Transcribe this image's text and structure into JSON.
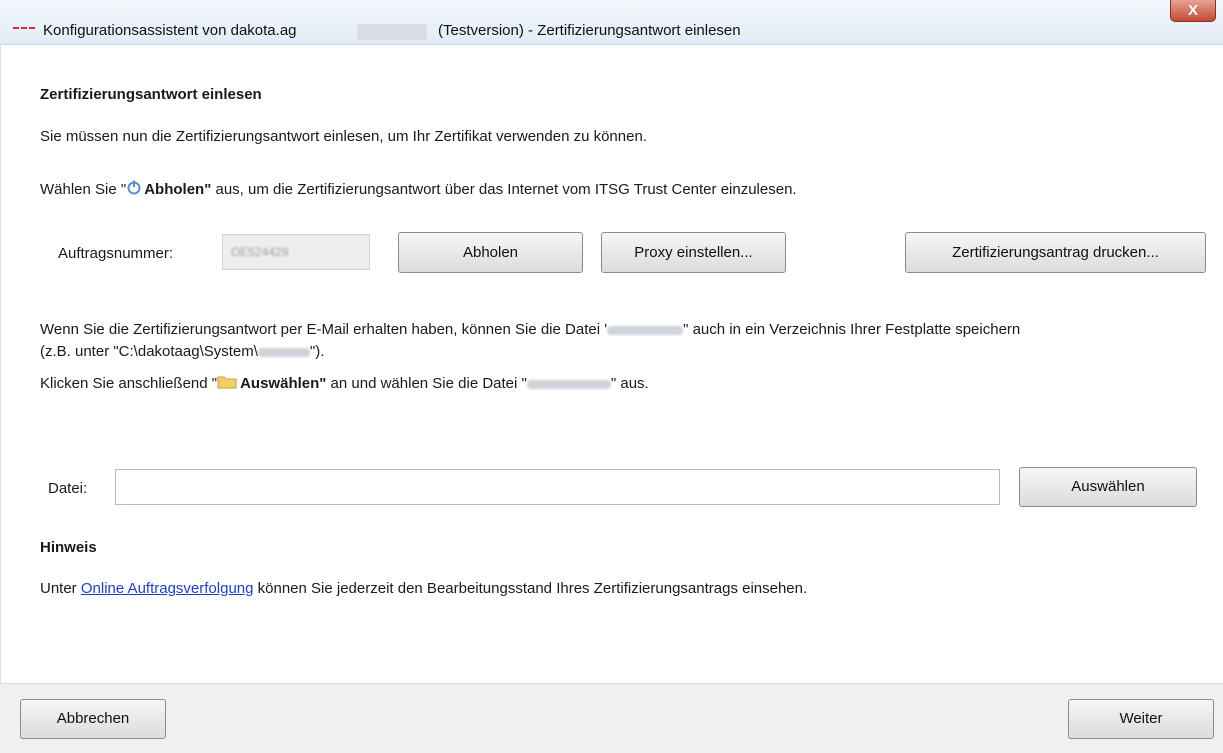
{
  "window": {
    "title_prefix": "Konfigurationsassistent von dakota.ag",
    "title_suffix": "(Testversion) - Zertifizierungsantwort einlesen",
    "close_glyph": "X"
  },
  "section": {
    "heading": "Zertifizierungsantwort einlesen",
    "intro": "Sie müssen nun die Zertifizierungsantwort einlesen, um Ihr Zertifikat verwenden zu können.",
    "fetch_pre": "Wählen Sie \"",
    "fetch_bold": "Abholen\"",
    "fetch_post": " aus, um die Zertifizierungsantwort über das Internet vom ITSG Trust Center einzulesen."
  },
  "order": {
    "label": "Auftragsnummer:",
    "value": "OE524429"
  },
  "buttons": {
    "fetch": "Abholen",
    "proxy": "Proxy einstellen...",
    "print_request": "Zertifizierungsantrag drucken...",
    "select": "Auswählen",
    "cancel": "Abbrechen",
    "next": "Weiter"
  },
  "email": {
    "line1_pre": "Wenn Sie die Zertifizierungsantwort per E-Mail erhalten haben, können Sie die Datei '",
    "line1_post": "\" auch in ein Verzeichnis Ihrer Festplatte speichern",
    "line2_pre": "(z.B. unter \"C:\\dakotaag\\System\\",
    "line2_post": "\").",
    "line3_pre": "Klicken Sie anschließend \"",
    "line3_bold": "Auswählen\"",
    "line3_mid": " an und wählen Sie die Datei \"",
    "line3_post": "\" aus."
  },
  "file": {
    "label": "Datei:",
    "value": "",
    "placeholder": ""
  },
  "hint": {
    "heading": "Hinweis",
    "pre": "Unter ",
    "link": "Online Auftragsverfolgung",
    "post": " können Sie jederzeit den Bearbeitungsstand Ihres Zertifizierungsantrags einsehen."
  },
  "colors": {
    "link": "#1a3fd6",
    "close_button": "#c24a33",
    "app_icon": "#d8312a"
  },
  "icons": {
    "fetch_inline": "power-icon",
    "select_inline": "folder-icon",
    "app": "app-icon",
    "close": "close-icon"
  }
}
